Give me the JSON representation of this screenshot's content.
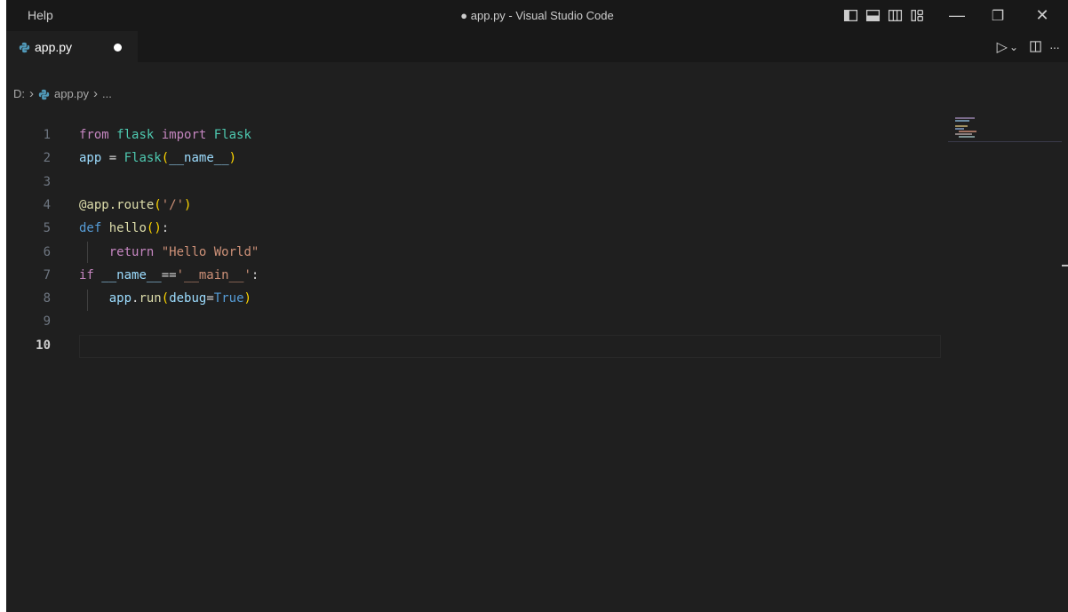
{
  "titlebar": {
    "menu_help": "Help",
    "title": "● app.py - Visual Studio Code",
    "layout_icons": [
      "toggle-primary-sidebar-icon",
      "toggle-panel-icon",
      "toggle-secondary-sidebar-icon",
      "customize-layout-icon"
    ],
    "controls": {
      "minimize": "—",
      "restore": "❐",
      "close": "✕"
    }
  },
  "tab": {
    "icon": "python-file-icon",
    "label": "app.py",
    "dirty": true
  },
  "tab_actions": {
    "run": "▷",
    "run_dropdown": "⌄",
    "split": "◫",
    "more": "···"
  },
  "breadcrumb": {
    "drive": "D:",
    "sep1": "›",
    "file": "app.py",
    "sep2": "›",
    "more": "..."
  },
  "editor": {
    "active_line": 10,
    "lines": [
      {
        "n": "1",
        "tokens": [
          [
            "kw",
            "from"
          ],
          [
            "op",
            " "
          ],
          [
            "cls",
            "flask"
          ],
          [
            "op",
            " "
          ],
          [
            "kw",
            "import"
          ],
          [
            "op",
            " "
          ],
          [
            "cls",
            "Flask"
          ]
        ]
      },
      {
        "n": "2",
        "tokens": [
          [
            "var",
            "app"
          ],
          [
            "op",
            " = "
          ],
          [
            "cls",
            "Flask"
          ],
          [
            "p1",
            "("
          ],
          [
            "var",
            "__name__"
          ],
          [
            "p1",
            ")"
          ]
        ]
      },
      {
        "n": "3",
        "tokens": []
      },
      {
        "n": "4",
        "tokens": [
          [
            "fn",
            "@app.route"
          ],
          [
            "p1",
            "("
          ],
          [
            "str",
            "'/'"
          ],
          [
            "p1",
            ")"
          ]
        ]
      },
      {
        "n": "5",
        "tokens": [
          [
            "def",
            "def"
          ],
          [
            "op",
            " "
          ],
          [
            "fn",
            "hello"
          ],
          [
            "p1",
            "()"
          ],
          [
            "op",
            ":"
          ]
        ]
      },
      {
        "n": "6",
        "tokens": [
          [
            "op",
            "    "
          ],
          [
            "kw",
            "return"
          ],
          [
            "op",
            " "
          ],
          [
            "str",
            "\"Hello World\""
          ]
        ]
      },
      {
        "n": "7",
        "tokens": [
          [
            "kw",
            "if"
          ],
          [
            "op",
            " "
          ],
          [
            "var",
            "__name__"
          ],
          [
            "op",
            "=="
          ],
          [
            "str",
            "'__main__'"
          ],
          [
            "op",
            ":"
          ]
        ]
      },
      {
        "n": "8",
        "tokens": [
          [
            "op",
            "    "
          ],
          [
            "var",
            "app"
          ],
          [
            "op",
            "."
          ],
          [
            "fn",
            "run"
          ],
          [
            "p1",
            "("
          ],
          [
            "var",
            "debug"
          ],
          [
            "op",
            "="
          ],
          [
            "def",
            "True"
          ],
          [
            "p1",
            ")"
          ]
        ]
      },
      {
        "n": "9",
        "tokens": []
      },
      {
        "n": "10",
        "tokens": []
      }
    ]
  },
  "colors": {
    "editor_bg": "#1f1f1f",
    "titlebar_bg": "#181818",
    "python_icon": "#519aba"
  }
}
